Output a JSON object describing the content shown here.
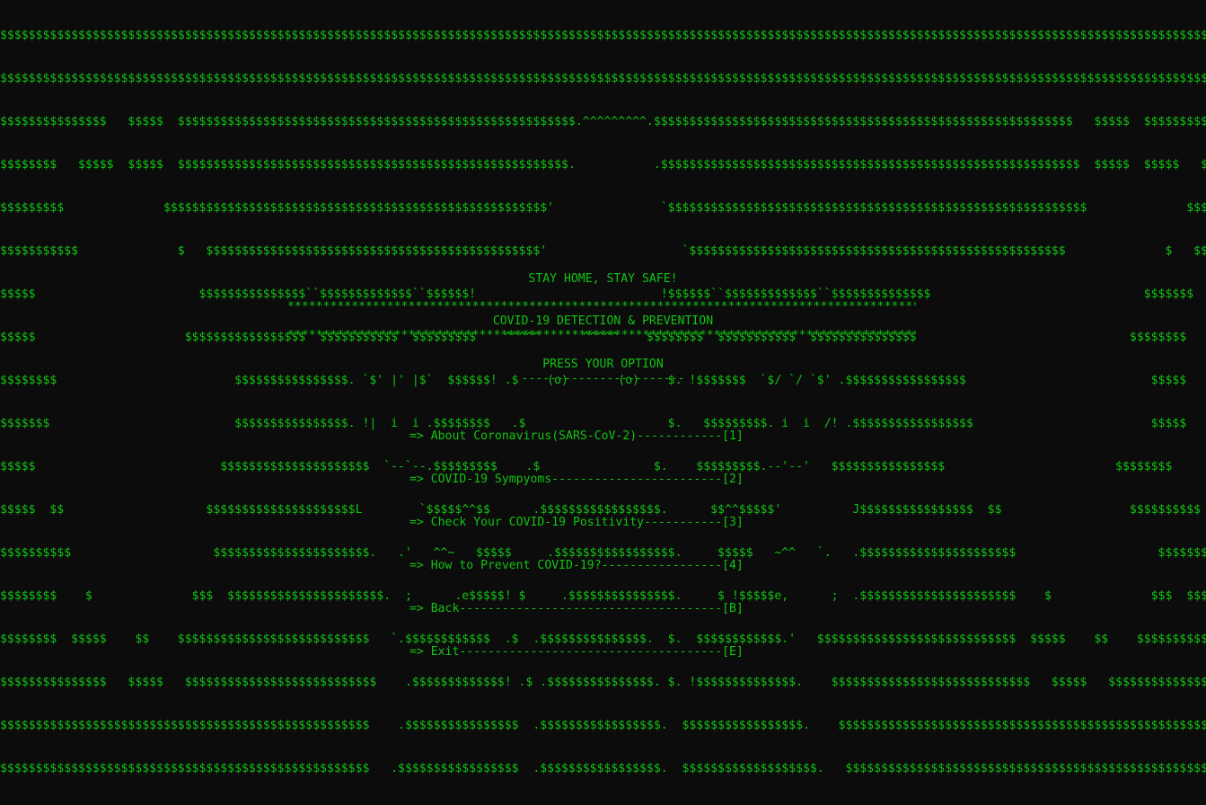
{
  "console": {
    "text_color": "#13c313",
    "background": "#0c0c0c",
    "art_lines": [
      "$$$$$$$$$$$$$$$$$$$$$$$$$$$$$$$$$$$$$$$$$$$$$$$$$$$$$$$$$$$$$$$$$$$$$$$$$$$$$$$$$$$$$$$$$$$$$$$$$$$$$$$$$$$$$$$$$$$$$$$$$$$$$$$$$$$$$$$$$$$$$$$$$$$$$$$$$$$$$$$$$$$$$$$$$$$$$$$$$$$$$$$$$$$$$$$$$$$$$$$$$$$$$$$$$$$$$$$$$$",
      "$$$$$$$$$$$$$$$$$$$$$$$$$$$$$$$$$$$$$$$$$$$$$$$$$$$$$$$$$$$$$$$$$$$$$$$$$$$$$$$$$$$$$$$$$$$$$$$$$$$$$$$$$$$$$$$$$$$$$$$$$$$$$$$$$$$$$$$$$$$$$$$$$$$$$$$$$$$$$$$$$$$$$$$$$$$$$$$$$$$$$$$$$$$$$$$$$$$$$$$$$$$$$$$$$$$$$$$$$$",
      "$$$$$$$$$$$$$$$   $$$$$  $$$$$$$$$$$$$$$$$$$$$$$$$$$$$$$$$$$$$$$$$$$$$$$$$$$$$$$$.^^^^^^^^^.$$$$$$$$$$$$$$$$$$$$$$$$$$$$$$$$$$$$$$$$$$$$$$$$$$$$$$$$$$$   $$$$$  $$$$$$$$$$$$$",
      "$$$$$$$$   $$$$$  $$$$$  $$$$$$$$$$$$$$$$$$$$$$$$$$$$$$$$$$$$$$$$$$$$$$$$$$$$$$$.           .$$$$$$$$$$$$$$$$$$$$$$$$$$$$$$$$$$$$$$$$$$$$$$$$$$$$$$$$$$$  $$$$$  $$$$$   $$$$$$$$",
      "$$$$$$$$$              $$$$$$$$$$$$$$$$$$$$$$$$$$$$$$$$$$$$$$$$$$$$$$$$$$$$$$'               `$$$$$$$$$$$$$$$$$$$$$$$$$$$$$$$$$$$$$$$$$$$$$$$$$$$$$$$$$$$              $$$$$$$$$$$$",
      "$$$$$$$$$$$              $   $$$$$$$$$$$$$$$$$$$$$$$$$$$$$$$$$$$$$$$$$$$$$$$'                   `$$$$$$$$$$$$$$$$$$$$$$$$$$$$$$$$$$$$$$$$$$$$$$$$$$$$$              $   $$$$$$$",
      "$$$$$                       $$$$$$$$$$$$$$$``$$$$$$$$$$$$$``$$$$$$!                          !$$$$$$``$$$$$$$$$$$$$``$$$$$$$$$$$$$$                              $$$$$$$",
      "$$$$$                     $$$$$$$$$$$$$$$$$  $$$$$$$$$$$  $$$$$$$$$    ^^^^^      ^^^^^    $$$$$$$$  $$$$$$$$$$$  $$$$$$$$$$$$$$$                              $$$$$$$$",
      "$$$$$$$$                         $$$$$$$$$$$$$$$$. `$' |' |$`  $$$$$$! .$    (o)       (o)    $. !$$$$$$$  `$/ `/ `$' .$$$$$$$$$$$$$$$$$                          $$$$$",
      "$$$$$$$                          $$$$$$$$$$$$$$$$. !|  i  i .$$$$$$$$   .$                    $.   $$$$$$$$$. i  i  /! .$$$$$$$$$$$$$$$$$                         $$$$$",
      "$$$$$                          $$$$$$$$$$$$$$$$$$$$$  `--`--.$$$$$$$$$    .$                $.    $$$$$$$$$.--'--'   $$$$$$$$$$$$$$$$                        $$$$$$$$",
      "$$$$$  $$                    $$$$$$$$$$$$$$$$$$$$$L        `$$$$$^^$$      .$$$$$$$$$$$$$$$$$.      $$^^$$$$$'          J$$$$$$$$$$$$$$$$  $$                  $$$$$$$$$$",
      "$$$$$$$$$$                    $$$$$$$$$$$$$$$$$$$$$$.   .'   ^^~   $$$$$     .$$$$$$$$$$$$$$$$$.     $$$$$   ~^^   `.   .$$$$$$$$$$$$$$$$$$$$$$                    $$$$$$$",
      "$$$$$$$$    $              $$$  $$$$$$$$$$$$$$$$$$$$$$.  ;      .e$$$$$! $     .$$$$$$$$$$$$$$$.     $ !$$$$$e,      ;  .$$$$$$$$$$$$$$$$$$$$$$    $              $$$  $$$$$$$",
      "$$$$$$$$  $$$$$    $$    $$$$$$$$$$$$$$$$$$$$$$$$$$$   `.$$$$$$$$$$$$  .$  .$$$$$$$$$$$$$$$.  $.  $$$$$$$$$$$$.'   $$$$$$$$$$$$$$$$$$$$$$$$$$$$  $$$$$    $$    $$$$$$$$$$$$",
      "$$$$$$$$$$$$$$$   $$$$$   $$$$$$$$$$$$$$$$$$$$$$$$$$$    .$$$$$$$$$$$$$! .$ .$$$$$$$$$$$$$$$. $. !$$$$$$$$$$$$$$.    $$$$$$$$$$$$$$$$$$$$$$$$$$$$   $$$$$   $$$$$$$$$$$$$$$",
      "$$$$$$$$$$$$$$$$$$$$$$$$$$$$$$$$$$$$$$$$$$$$$$$$$$$$    .$$$$$$$$$$$$$$$$  .$$$$$$$$$$$$$$$$$.  $$$$$$$$$$$$$$$$$.    $$$$$$$$$$$$$$$$$$$$$$$$$$$$$$$$$$$$$$$$$$$$$$$$$$$$$$$$",
      "$$$$$$$$$$$$$$$$$$$$$$$$$$$$$$$$$$$$$$$$$$$$$$$$$$$$   .$$$$$$$$$$$$$$$$$  .$$$$$$$$$$$$$$$$$.  $$$$$$$$$$$$$$$$$$$.   $$$$$$$$$$$$$$$$$$$$$$$$$$$$$$$$$$$$$$$$$$$$$$$$$$$$$$$$"
    ],
    "slogan": "STAY HOME, STAY SAFE!",
    "stars_line": "************************************************************************************************************",
    "heading": "COVID-19 DETECTION & PREVENTION",
    "prompt": "PRESS YOUR OPTION",
    "prompt_underline": "-----------------------",
    "menu": [
      "=> About Coronavirus(SARS-CoV-2)------------[1]",
      "=> COVID-19 Sympyoms------------------------[2]",
      "=> Check Your COVID-19 Positivity-----------[3]",
      "=> How to Prevent COVID-19?-----------------[4]",
      "=> Back-------------------------------------[B]",
      "=> Exit-------------------------------------[E]"
    ]
  }
}
